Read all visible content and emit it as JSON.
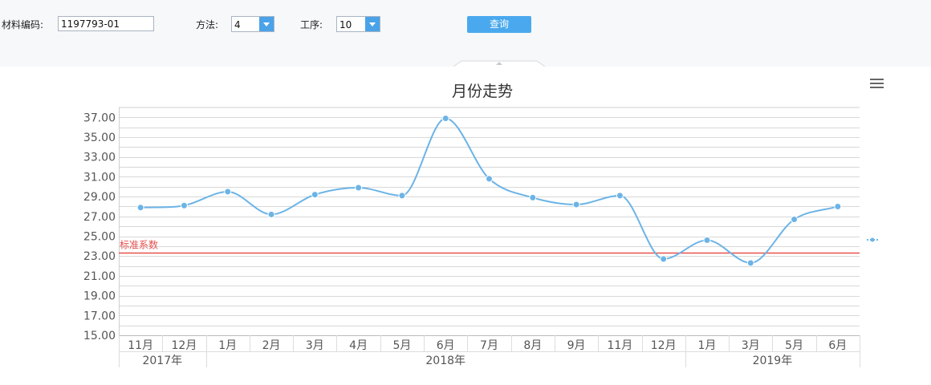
{
  "form": {
    "material_label": "材料编码:",
    "material_value": "1197793-01",
    "method_label": "方法:",
    "method_value": "4",
    "process_label": "工序:",
    "process_value": "10",
    "query_label": "查询"
  },
  "colors": {
    "line": "#6cb4e6",
    "standard": "#e8514d",
    "toolbar": "#f7f8fa",
    "button": "#4aa9ee"
  },
  "icons": {
    "menu": "hamburger-menu-icon",
    "dropdown": "chevron-down-icon"
  },
  "chart_data": {
    "type": "line",
    "title": "月份走势",
    "xlabel": "",
    "ylabel": "",
    "ylim": [
      15,
      38
    ],
    "yticks": [
      "15.00",
      "17.00",
      "19.00",
      "21.00",
      "23.00",
      "25.00",
      "27.00",
      "29.00",
      "31.00",
      "33.00",
      "35.00",
      "37.00"
    ],
    "categories": [
      "11月",
      "12月",
      "1月",
      "2月",
      "3月",
      "4月",
      "5月",
      "6月",
      "7月",
      "8月",
      "9月",
      "11月",
      "12月",
      "1月",
      "3月",
      "5月",
      "6月"
    ],
    "groups": [
      {
        "label": "2017年",
        "count": 2
      },
      {
        "label": "2018年",
        "count": 11
      },
      {
        "label": "2019年",
        "count": 4
      }
    ],
    "series": [
      {
        "values": [
          27.9,
          28.1,
          29.5,
          27.2,
          29.2,
          29.9,
          29.1,
          36.9,
          30.8,
          28.9,
          28.2,
          29.1,
          22.7,
          24.6,
          22.3,
          26.7,
          28.0
        ]
      }
    ],
    "standard": {
      "label": "标准系数",
      "value": 23.3
    },
    "grid": true,
    "legend": "right"
  }
}
